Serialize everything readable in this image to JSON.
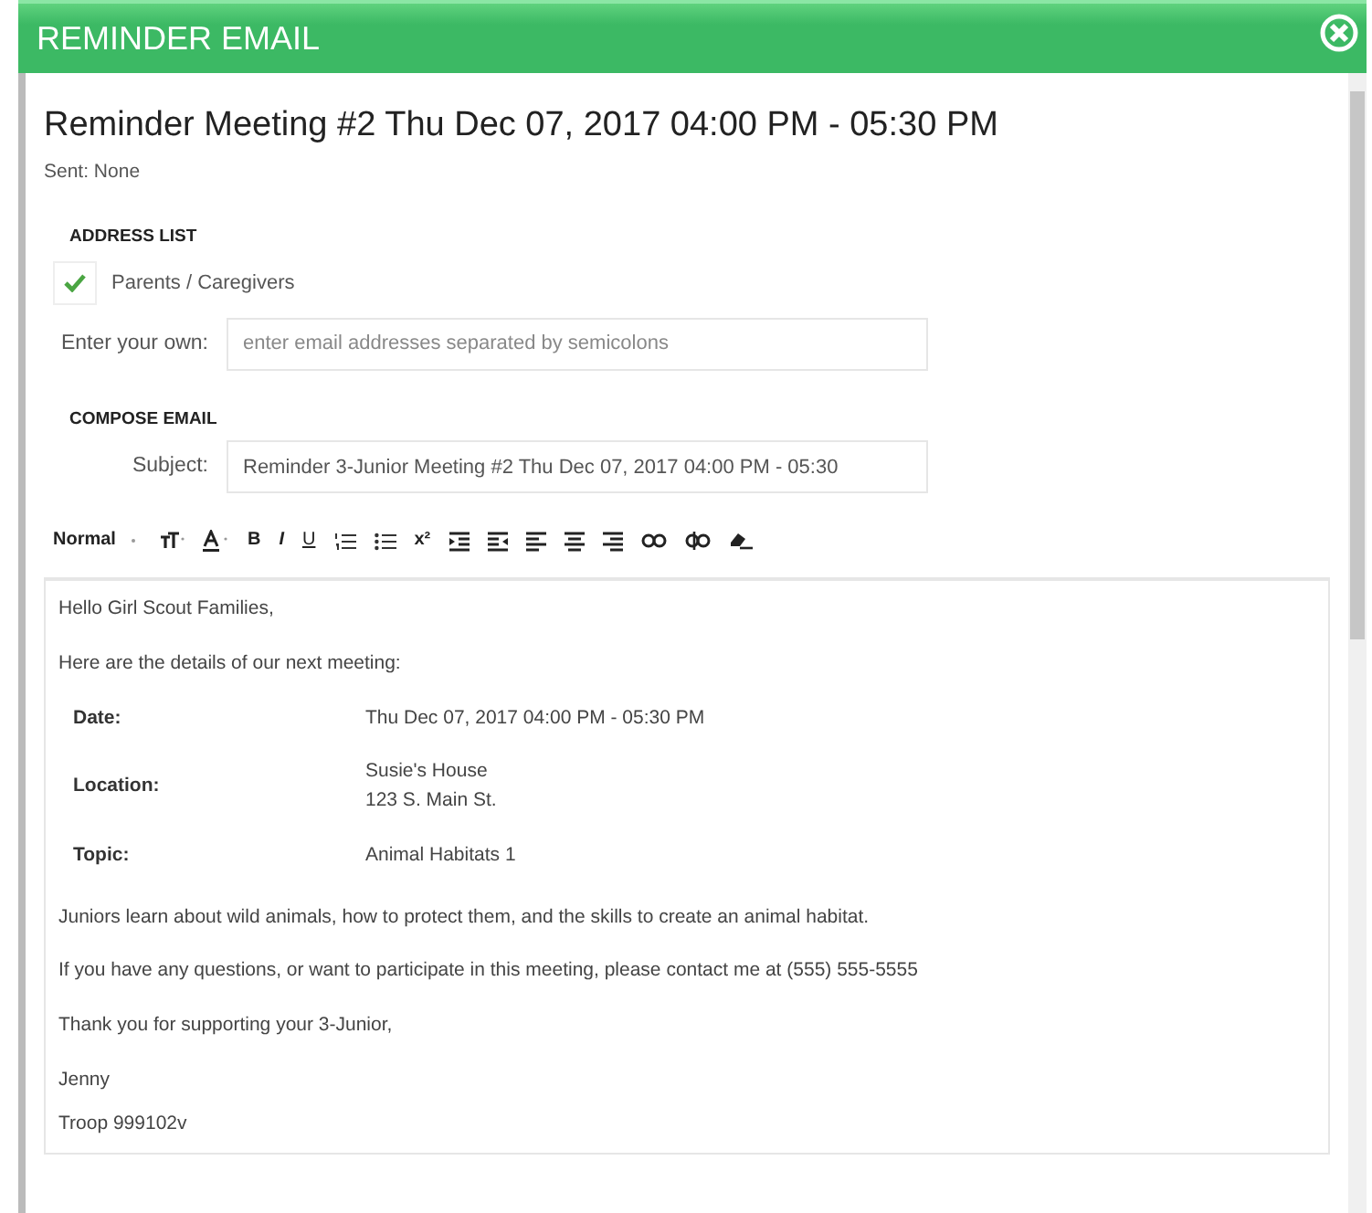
{
  "window": {
    "title": "REMINDER EMAIL"
  },
  "heading": "Reminder Meeting #2 Thu Dec 07, 2017 04:00 PM - 05:30 PM",
  "sent": "Sent: None",
  "address_list": {
    "label": "ADDRESS LIST",
    "groups": [
      {
        "label": "Parents / Caregivers",
        "checked": true
      }
    ],
    "own": {
      "label": "Enter your own:",
      "placeholder": "enter email addresses separated by semicolons"
    }
  },
  "compose": {
    "label": "COMPOSE EMAIL",
    "subject_label": "Subject:",
    "subject": "Reminder 3-Junior Meeting #2 Thu Dec 07, 2017 04:00 PM - 05:30"
  },
  "toolbar": [
    {
      "kind": "style",
      "label": "Normal"
    },
    {
      "kind": "size"
    },
    {
      "kind": "color"
    },
    {
      "kind": "bold",
      "label": "B"
    },
    {
      "kind": "italic",
      "label": "I"
    },
    {
      "kind": "underline",
      "label": "U"
    },
    {
      "kind": "ordered-list"
    },
    {
      "kind": "bullet-list"
    },
    {
      "kind": "superscript",
      "label": "x²"
    },
    {
      "kind": "indent"
    },
    {
      "kind": "outdent"
    },
    {
      "kind": "align-left"
    },
    {
      "kind": "align-center"
    },
    {
      "kind": "align-right"
    },
    {
      "kind": "link"
    },
    {
      "kind": "unlink"
    },
    {
      "kind": "eraser"
    }
  ],
  "body": {
    "greeting": "Hello Girl Scout Families,",
    "intro": "Here are the details of our next meeting:",
    "details": [
      {
        "label": "Date:",
        "lines": [
          "Thu Dec 07, 2017 04:00 PM - 05:30 PM"
        ]
      },
      {
        "label": "Location:",
        "lines": [
          "Susie's House",
          "123 S. Main St."
        ]
      },
      {
        "label": "Topic:",
        "lines": [
          "Animal Habitats 1"
        ]
      }
    ],
    "paragraphs": [
      "Juniors learn about wild animals, how to protect them, and the skills to create an animal habitat.",
      "If you have any questions, or want to participate in this meeting, please contact me at (555) 555-5555",
      "Thank you for supporting your 3-Junior,"
    ],
    "signature": [
      "Jenny",
      "Troop 999102v"
    ]
  }
}
